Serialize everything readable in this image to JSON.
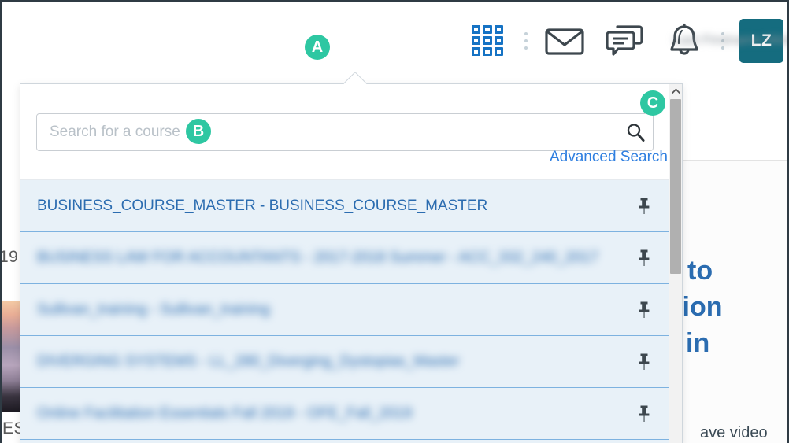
{
  "header": {
    "badge_a": "A",
    "apps_icon": "grid-apps-icon",
    "mail_icon": "envelope-icon",
    "chat_icon": "chat-bubbles-icon",
    "bell_icon": "bell-icon",
    "avatar_initials": "LZ",
    "user_name": "Last Firstname Middlename"
  },
  "dropdown": {
    "badge_b": "B",
    "badge_c": "C",
    "search": {
      "placeholder": "Search for a course",
      "value": "",
      "icon": "search-magnifier-icon"
    },
    "advanced_search_label": "Advanced Search",
    "pin_icon": "pushpin-icon",
    "scroll_up_icon": "chevron-up-icon",
    "courses": [
      {
        "title": "BUSINESS_COURSE_MASTER - BUSINESS_COURSE_MASTER",
        "blurred": false
      },
      {
        "title": "BUSINESS LAW FOR ACCOUNTANTS - 2017-2018 Summer - ACC_332_240_2017",
        "blurred": true
      },
      {
        "title": "Sullivan_training - Sullivan_training",
        "blurred": true
      },
      {
        "title": "DIVERGING SYSTEMS - LL_280_Diverging_Dystopias_Master",
        "blurred": true
      },
      {
        "title": "Online Facilitation Essentials Fall 2019 - OFE_Fall_2019",
        "blurred": true
      }
    ]
  },
  "background": {
    "year_fragment": "19",
    "es_fragment": "ES",
    "heading_lines": [
      "eed to",
      "mission",
      "eos in"
    ],
    "sub_text": "ave video"
  },
  "colors": {
    "badge_teal": "#2ec7a2",
    "avatar_teal": "#156c7f",
    "link_blue": "#2f7fe0",
    "row_bg": "#e8f1f8",
    "row_border": "#7db2e0",
    "grid_icon_blue": "#1673c4"
  }
}
